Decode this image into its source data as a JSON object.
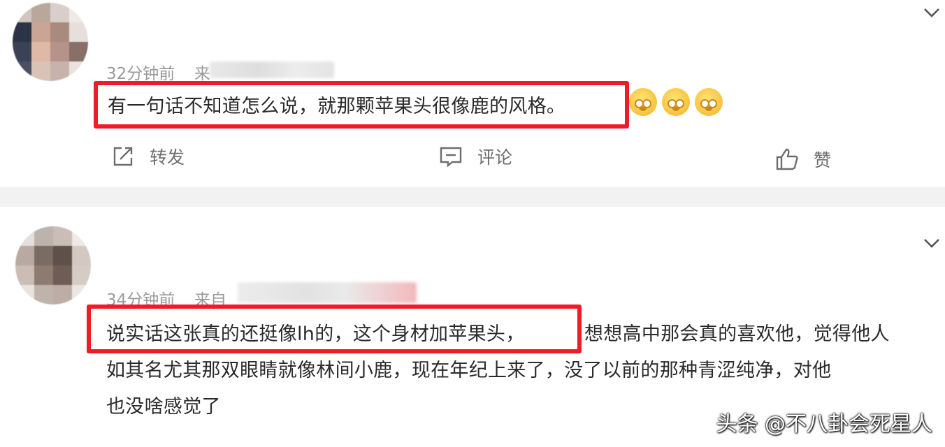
{
  "comments": [
    {
      "time": "32分钟前",
      "source_prefix": "来",
      "text": "有一句话不知道怎么说，就那颗苹果头很像鹿的风格。",
      "emoji_icons": [
        "laughing-cry-emoji",
        "laughing-cry-emoji",
        "laughing-cry-emoji"
      ],
      "actions": {
        "repost_label": "转发",
        "comment_label": "评论",
        "like_label": "赞"
      }
    },
    {
      "time": "34分钟前",
      "source_prefix": "来自",
      "text_line1_highlighted": "说实话这张真的还挺像lh的，这个身材加苹果头，",
      "text_line1_rest": "想想高中那会真的喜欢他，觉得他人",
      "text_line2": "如其名尤其那双眼睛就像林间小鹿，现在年纪上来了，没了以前的那种青涩纯净，对他",
      "text_line3": "也没啥感觉了"
    }
  ],
  "watermark": "头条 @不八卦会死星人",
  "colors": {
    "highlight_border": "#ee1c25",
    "meta_text": "#9a9a9a",
    "body_text": "#2a2a2a",
    "divider": "#f2f2f2"
  }
}
